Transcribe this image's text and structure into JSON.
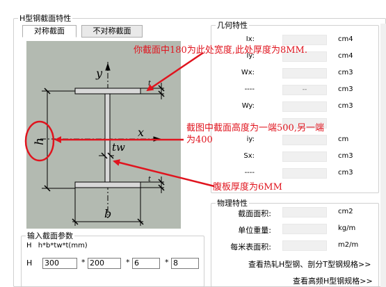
{
  "section_title": "H型钢截面特性",
  "tabs": [
    {
      "label": "对称截面",
      "active": true
    },
    {
      "label": "不对称截面",
      "active": false
    }
  ],
  "diagram": {
    "axis_y": "y",
    "axis_x": "x",
    "label_h": "h",
    "label_tw": "tw",
    "label_b": "b",
    "label_t": "t"
  },
  "geometry": {
    "title": "几何特性",
    "rows": [
      {
        "label": "Ix:",
        "value": "",
        "unit": "cm4"
      },
      {
        "label": "Iy:",
        "value": "",
        "unit": "cm4"
      },
      {
        "label": "Wx:",
        "value": "",
        "unit": "cm3"
      },
      {
        "label": "----",
        "value": "--",
        "unit": "cm3"
      },
      {
        "label": "Wy:",
        "value": "",
        "unit": "cm3"
      },
      {
        "label": "",
        "value": "",
        "unit": ""
      },
      {
        "label": "iy:",
        "value": "",
        "unit": "cm"
      },
      {
        "label": "Sx:",
        "value": "",
        "unit": "cm3"
      },
      {
        "label": "----",
        "value": "",
        "unit": "cm3"
      }
    ]
  },
  "physical": {
    "title": "物理特性",
    "rows": [
      {
        "label": "截面面积:",
        "value": "",
        "unit": "cm2"
      },
      {
        "label": "单位重量:",
        "value": "",
        "unit": "kg/m"
      },
      {
        "label": "每米表面积:",
        "value": "",
        "unit": "m2/m"
      }
    ],
    "link_hot": "查看热轧H型钢、剖分T型钢规格>>",
    "link_high": "查看高频H型钢规格>>"
  },
  "input": {
    "title": "输入截面参数",
    "formula_prefix": "H",
    "formula": "h*b*tw*t(mm)",
    "h_label": "H",
    "sep": "*",
    "h": "300",
    "b": "200",
    "tw": "6",
    "t": "8"
  },
  "annotations": {
    "flange": "你截面中180为此处宽度,此处厚度为8MM.",
    "height_line1": "截图中截面高度为一端500,另一端",
    "height_line2": "为400",
    "web": "腹板厚度为6MM"
  },
  "colors": {
    "annotation": "#e0141e",
    "diagram_bg": "#b3bab1"
  }
}
